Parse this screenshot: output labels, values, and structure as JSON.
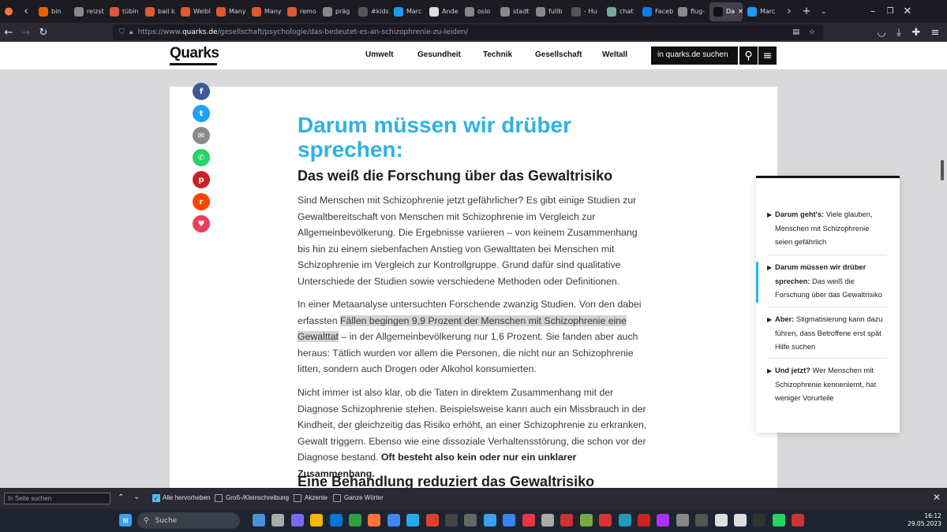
{
  "browser": {
    "tabs": [
      {
        "label": "bin",
        "icon": "firefox-icon",
        "color": "#e66000"
      },
      {
        "label": "reizst",
        "icon": "google-icon",
        "color": "#888"
      },
      {
        "label": "tübin",
        "icon": "duckduckgo-icon",
        "color": "#de5833"
      },
      {
        "label": "ball k",
        "icon": "duckduckgo-icon",
        "color": "#de5833"
      },
      {
        "label": "Weibl",
        "icon": "duckduckgo-icon",
        "color": "#de5833"
      },
      {
        "label": "Many",
        "icon": "duckduckgo-icon",
        "color": "#de5833"
      },
      {
        "label": "Many",
        "icon": "duckduckgo-icon",
        "color": "#de5833"
      },
      {
        "label": "remo",
        "icon": "duckduckgo-icon",
        "color": "#de5833"
      },
      {
        "label": "präg",
        "icon": "google-icon",
        "color": "#888"
      },
      {
        "label": "#kids",
        "icon": "hashtag-icon",
        "color": "#555"
      },
      {
        "label": "Marc",
        "icon": "twitter-icon",
        "color": "#1d9bf0"
      },
      {
        "label": "Ande",
        "icon": "wikipedia-icon",
        "color": "#ddd"
      },
      {
        "label": "oslo",
        "icon": "google-icon",
        "color": "#888"
      },
      {
        "label": "stadt",
        "icon": "google-icon",
        "color": "#888"
      },
      {
        "label": "fullb",
        "icon": "google-icon",
        "color": "#888"
      },
      {
        "label": "- Hu",
        "icon": "github-icon",
        "color": "#555"
      },
      {
        "label": "chat",
        "icon": "chatgpt-icon",
        "color": "#74aa9c"
      },
      {
        "label": "Faceb",
        "icon": "facebook-icon",
        "color": "#1877f2"
      },
      {
        "label": "flug-",
        "icon": "google-icon",
        "color": "#888"
      },
      {
        "label": "Da",
        "icon": "quarks-icon",
        "color": "#111",
        "active": true
      },
      {
        "label": "Marc",
        "icon": "twitter-icon",
        "color": "#1d9bf0"
      }
    ],
    "url_prefix": "https://www.",
    "url_host": "quarks.de",
    "url_path": "/gesellschaft/psychologie/das-bedeutet-es-an-schizophrenie-zu-leiden/"
  },
  "site": {
    "logo": "Quarks",
    "menu": [
      "Umwelt",
      "Gesundheit",
      "Technik",
      "Gesellschaft",
      "Weltall"
    ],
    "search_placeholder": "in quarks.de suchen"
  },
  "share": [
    {
      "name": "facebook",
      "color": "#3b5998",
      "glyph": "f"
    },
    {
      "name": "twitter",
      "color": "#1da1f2",
      "glyph": "t"
    },
    {
      "name": "email",
      "color": "#8a8a8a",
      "glyph": "✉"
    },
    {
      "name": "whatsapp",
      "color": "#25d366",
      "glyph": "✆"
    },
    {
      "name": "pinterest",
      "color": "#cb2027",
      "glyph": "p"
    },
    {
      "name": "reddit",
      "color": "#ff4500",
      "glyph": "r"
    },
    {
      "name": "pocket",
      "color": "#ef3f56",
      "glyph": "♥"
    }
  ],
  "article": {
    "heading": "Darum müssen wir drüber sprechen:",
    "subheading": "Das weiß die Forschung über das Gewaltrisiko",
    "p1": "Sind Menschen mit Schizophrenie jetzt gefährlicher? Es gibt einige Studien zur Gewaltbereitschaft von Menschen mit Schizophrenie im Vergleich zur Allgemeinbevölkerung. Die Ergebnisse variieren – von keinem Zusammenhang bis hin zu einem siebenfachen Anstieg von Gewalttaten bei Menschen mit Schizophrenie im Vergleich zur Kontrollgruppe. Grund dafür sind qualitative Unterschiede der Studien sowie verschiedene Methoden oder Definitionen.",
    "p2_a": "In einer Metaanalyse untersuchten Forschende zwanzig Studien. Von den dabei erfassten ",
    "p2_highlight": "Fällen begingen 9,9 Prozent der Menschen mit Schizophrenie eine Gewalttat",
    "p2_b": " – in der Allgemeinbevölkerung nur 1,6 Prozent. Sie fanden aber auch heraus: Tätlich wurden vor allem die Personen, die nicht nur an Schizophrenie litten, sondern auch Drogen oder Alkohol konsumierten.",
    "p3_a": "Nicht immer ist also klar, ob die Taten in direktem Zusammenhang mit der Diagnose Schizophrenie stehen. Beispielsweise kann auch ein Missbrauch in der Kindheit, der gleichzeitig das Risiko erhöht, an einer Schizophrenie zu erkranken, Gewalt triggern. Ebenso wie eine dissoziale Verhaltensstörung, die schon vor der Diagnose bestand. ",
    "p3_bold": "Oft besteht also kein oder nur ein unklarer Zusammenhang.",
    "next_heading": "Eine Behandlung reduziert das Gewaltrisiko"
  },
  "toc": [
    {
      "bold": "Darum geht's:",
      "text": " Viele glauben, Menschen mit Schizophrenie seien gefährlich",
      "active": false
    },
    {
      "bold": "Darum müssen wir drüber sprechen:",
      "text": " Das weiß die Forschung über das Gewaltrisiko",
      "active": true
    },
    {
      "bold": "Aber:",
      "text": " Stigmatisierung kann dazu führen, dass Betroffene erst spät Hilfe suchen",
      "active": false
    },
    {
      "bold": "Und jetzt?",
      "text": " Wer Menschen mit Schizophrenie kennenlernt, hat weniger Vorurteile",
      "active": false
    }
  ],
  "findbar": {
    "placeholder": "In Seite suchen",
    "options": [
      {
        "label": "Alle hervorheben",
        "checked": true
      },
      {
        "label": "Groß-/Kleinschreibung",
        "checked": false
      },
      {
        "label": "Akzente",
        "checked": false
      },
      {
        "label": "Ganze Wörter",
        "checked": false
      }
    ]
  },
  "taskbar": {
    "search_label": "Suche",
    "time": "16:12",
    "date": "29.05.2023"
  },
  "colors": {
    "accent": "#2bb3e6"
  }
}
